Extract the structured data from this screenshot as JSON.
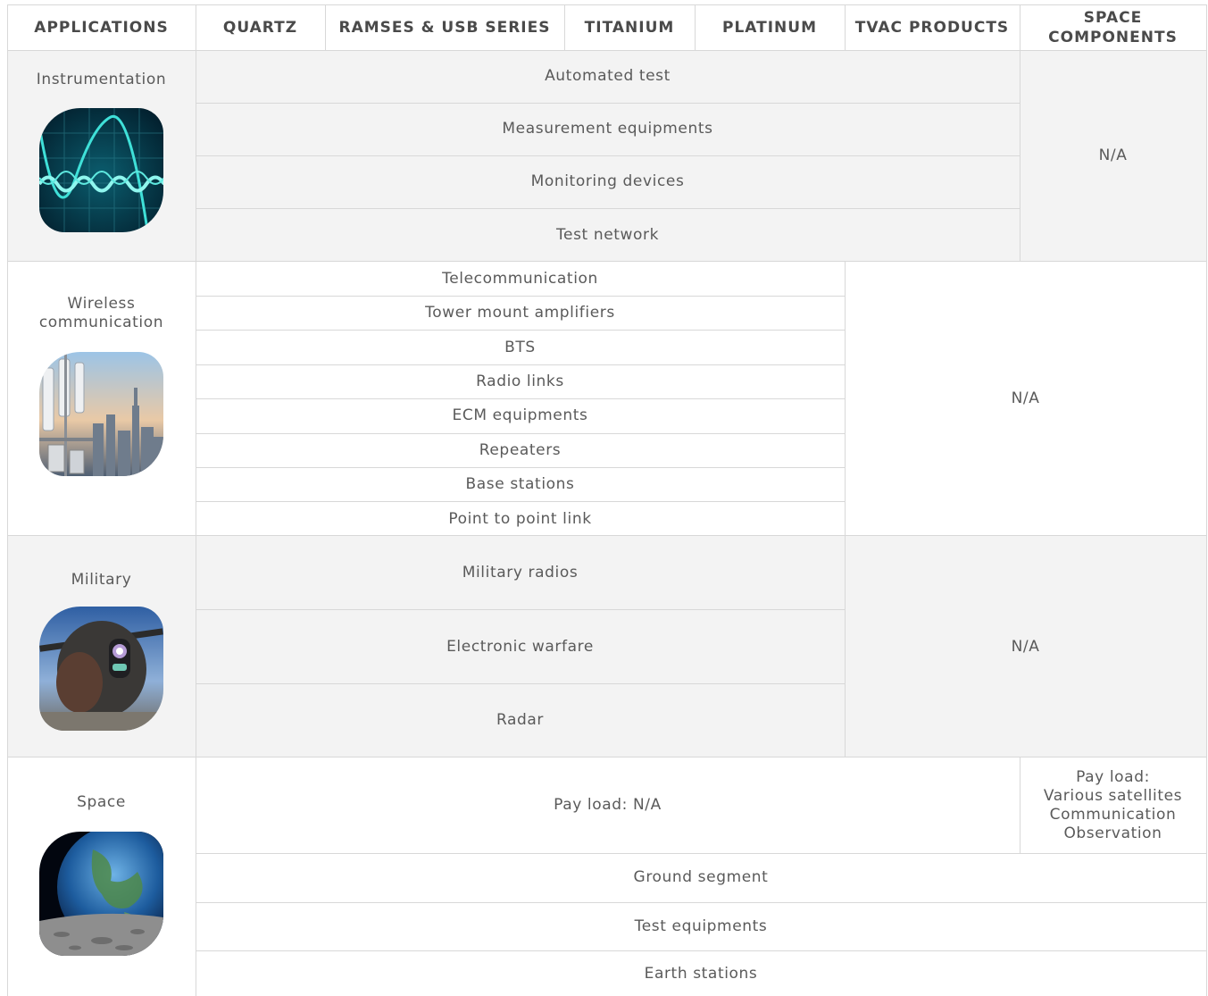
{
  "header": {
    "applications": "APPLICATIONS",
    "quartz": "QUARTZ",
    "ramses": "RAMSES & USB SERIES",
    "titanium": "TITANIUM",
    "platinum": "PLATINUM",
    "tvac": "TVAC PRODUCTS",
    "space_components_1": "SPACE",
    "space_components_2": "COMPONENTS"
  },
  "instrumentation": {
    "name": "Instrumentation",
    "icon": "oscilloscope-image",
    "items": [
      "Automated test",
      "Measurement equipments",
      "Monitoring devices",
      "Test network"
    ],
    "na": "N/A"
  },
  "wireless": {
    "name_1": "Wireless",
    "name_2": "communication",
    "icon": "antenna-tower-image",
    "items": [
      "Telecommunication",
      "Tower mount amplifiers",
      "BTS",
      "Radio links",
      "ECM equipments",
      "Repeaters",
      "Base stations",
      "Point to point link"
    ],
    "na": "N/A"
  },
  "military": {
    "name": "Military",
    "icon": "helicopter-image",
    "items": [
      "Military radios",
      "Electronic warfare",
      "Radar"
    ],
    "na": "N/A"
  },
  "space": {
    "name": "Space",
    "icon": "earth-image",
    "payload": "Pay load: N/A",
    "payload_right": [
      "Pay load:",
      "Various satellites",
      "Communication",
      "Observation"
    ],
    "items": [
      "Ground segment",
      "Test equipments",
      "Earth stations"
    ]
  },
  "colors": {
    "row_gray": "#f3f3f3",
    "border": "#d8d8d8",
    "text": "#5a5a5a"
  }
}
